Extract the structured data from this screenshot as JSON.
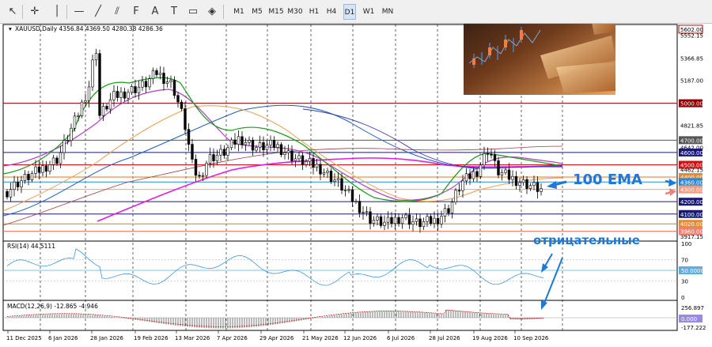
{
  "toolbar": {
    "tools": [
      {
        "name": "cursor-icon",
        "glyph": "↖"
      },
      {
        "name": "crosshair-icon",
        "glyph": "✛"
      },
      {
        "name": "vertical-line-icon",
        "glyph": "│"
      },
      {
        "name": "horizontal-line-icon",
        "glyph": "—"
      },
      {
        "name": "trendline-icon",
        "glyph": "╱"
      },
      {
        "name": "channel-icon",
        "glyph": "⫽"
      },
      {
        "name": "fibonacci-icon",
        "glyph": "F"
      },
      {
        "name": "text-icon",
        "glyph": "A"
      },
      {
        "name": "label-icon",
        "glyph": "T"
      },
      {
        "name": "rectangle-icon",
        "glyph": "▭"
      },
      {
        "name": "shapes-icon",
        "glyph": "◈"
      }
    ],
    "timeframes": [
      "M1",
      "M5",
      "M15",
      "M30",
      "H1",
      "H4",
      "D1",
      "W1",
      "MN"
    ],
    "active_timeframe": "D1"
  },
  "chart": {
    "header": "XAUUSD,Daily  4356.84 4369.50 4280.38 4286.36",
    "price_levels": [
      {
        "label": "5602.00",
        "style": "boxed-red"
      },
      {
        "label": "5552.15",
        "style": "plain"
      },
      {
        "label": "5366.85",
        "style": "plain"
      },
      {
        "label": "5187.00",
        "style": "plain"
      },
      {
        "label": "5000.00",
        "style": "dark-red"
      },
      {
        "label": "4821.85",
        "style": "plain"
      },
      {
        "label": "4700.00",
        "style": "dark-gray"
      },
      {
        "label": "4642.00",
        "style": "plain"
      },
      {
        "label": "4600.00",
        "style": "navy"
      },
      {
        "label": "4500.00",
        "style": "red"
      },
      {
        "label": "4462.15",
        "style": "plain"
      },
      {
        "label": "4400.00",
        "style": "orange"
      },
      {
        "label": "4360.00",
        "style": "blue"
      },
      {
        "label": "4300.00",
        "style": "peach"
      },
      {
        "label": "4200.00",
        "style": "navy"
      },
      {
        "label": "4100.00",
        "style": "navy"
      },
      {
        "label": "4020.00",
        "style": "orange"
      },
      {
        "label": "3960.00",
        "style": "salmon"
      },
      {
        "label": "3917.15",
        "style": "plain"
      }
    ],
    "annotations": {
      "ema_label": "100 EMA",
      "negative_label": "отрицательные"
    },
    "date_labels": [
      "11 Dec 2025",
      "6 Jan 2026",
      "28 Jan 2026",
      "19 Feb 2026",
      "13 Mar 2026",
      "7 Apr 2026",
      "29 Apr 2026",
      "21 May 2026",
      "12 Jun 2026",
      "6 Jul 2026",
      "28 Jul 2026",
      "19 Aug 2026",
      "10 Sep 2026"
    ]
  },
  "rsi": {
    "header": "RSI(14) 44.5111",
    "scale": [
      "100",
      "70",
      "50.0000",
      "30",
      "0"
    ]
  },
  "macd": {
    "header": "MACD(12,26,9) -12.865 -4.946",
    "scale": [
      "256.897",
      "0.000",
      "-177.222"
    ]
  },
  "colors": {
    "candle": "#000000",
    "ema_fast": "#1a9a1a",
    "ema_mid": "#b040c0",
    "ema_100": "#2060c0",
    "sma_slow": "#e8a050",
    "ema_magenta": "#e020e0",
    "annotation_blue": "#1e78d6",
    "annotation_pink": "#f08080"
  }
}
